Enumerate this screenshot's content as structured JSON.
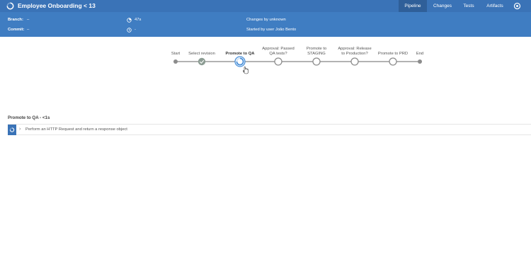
{
  "header": {
    "title": "Employee Onboarding < 13",
    "tabs": [
      {
        "label": "Pipeline",
        "active": true
      },
      {
        "label": "Changes",
        "active": false
      },
      {
        "label": "Tests",
        "active": false
      },
      {
        "label": "Artifacts",
        "active": false
      }
    ],
    "icons": {
      "status": "running-spinner-icon",
      "logout": "logout-icon"
    }
  },
  "info": {
    "branch_label": "Branch:",
    "branch_value": "–",
    "commit_label": "Commit:",
    "commit_value": "–",
    "duration": "47s",
    "started": "-",
    "changes": "Changes by unknown",
    "started_by": "Started by user João Bento"
  },
  "pipeline": {
    "stages": [
      {
        "label": "Start",
        "state": "start"
      },
      {
        "label": "Select revision",
        "state": "success"
      },
      {
        "label": "Promote to QA",
        "state": "running"
      },
      {
        "label": "Approval: Passed\nQA tests?",
        "state": "not-built"
      },
      {
        "label": "Promote to\nSTAGING",
        "state": "not-built"
      },
      {
        "label": "Approval: Release\nto Production?",
        "state": "not-built"
      },
      {
        "label": "Promote to PRD",
        "state": "not-built"
      },
      {
        "label": "End",
        "state": "end"
      }
    ],
    "selected_stage": "Promote to QA"
  },
  "steps": {
    "title": "Promote to QA - <1s",
    "items": [
      {
        "text": "Perform an HTTP Request and return a response object",
        "status": "running"
      }
    ]
  },
  "colors": {
    "topbar": "#3a73b7",
    "infobar": "#3f7dc2",
    "active_tab": "#2f5f99",
    "running": "#4a90d9",
    "success": "#8d9d94",
    "line": "#9a9a9a"
  }
}
